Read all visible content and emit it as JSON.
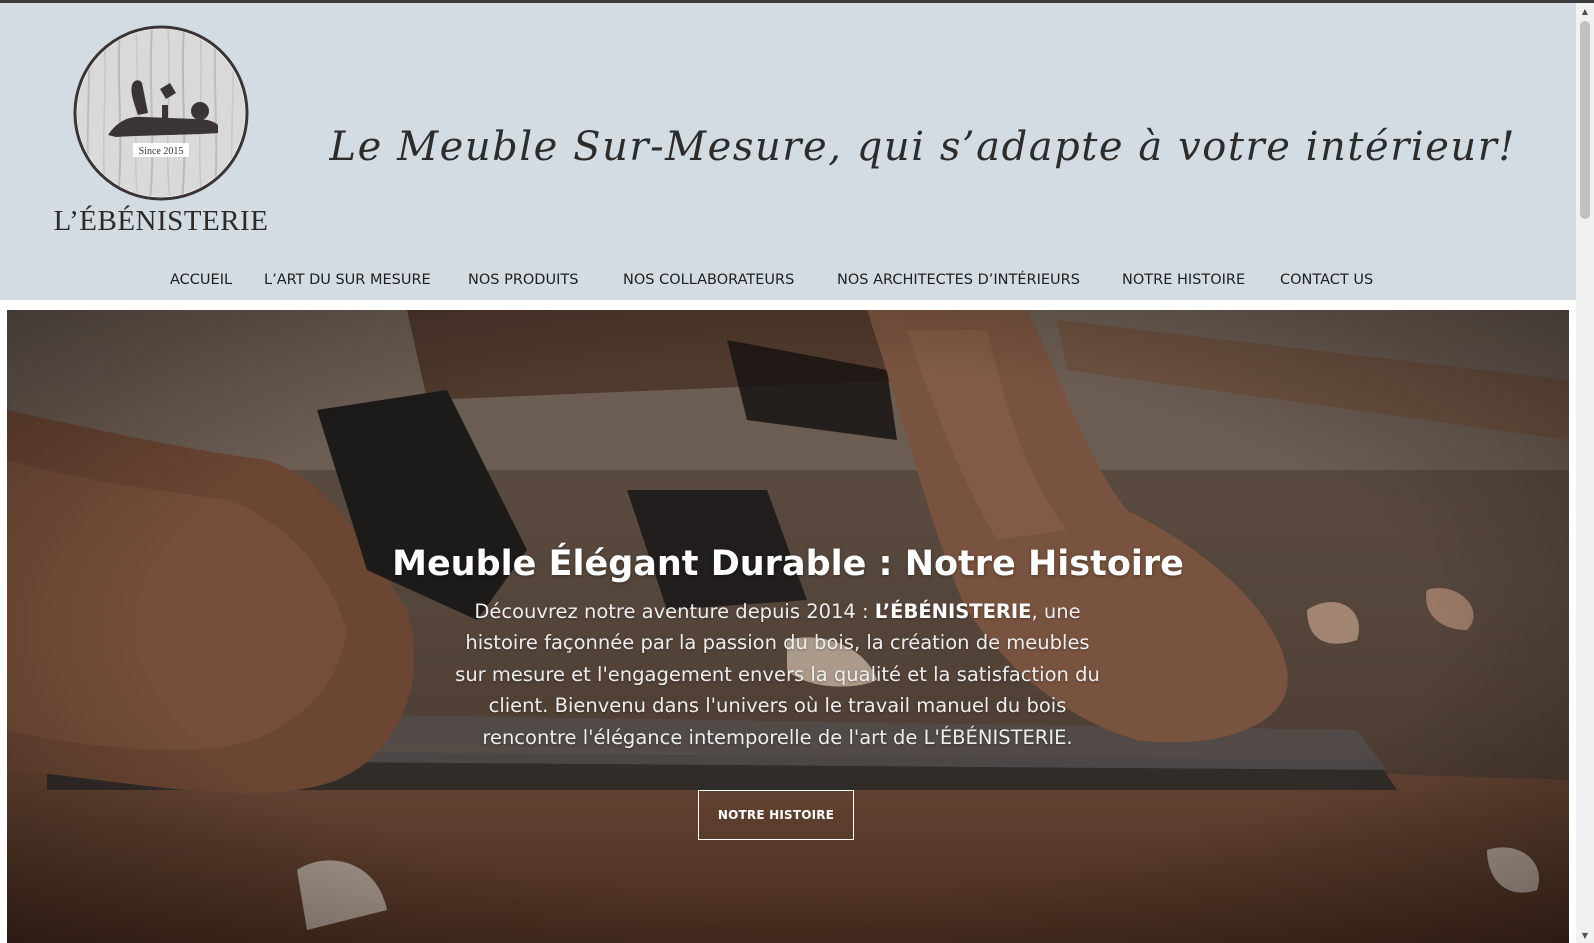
{
  "header": {
    "logo": {
      "badge_text": "Since 2015",
      "brand_name": "L’ÉBÉNISTERIE"
    },
    "tagline": "Le Meuble Sur-Mesure, qui s’adapte à votre intérieur!"
  },
  "nav": {
    "items": [
      {
        "label": "ACCUEIL"
      },
      {
        "label": "L’ART DU SUR MESURE"
      },
      {
        "label": "NOS PRODUITS"
      },
      {
        "label": "NOS COLLABORATEURS"
      },
      {
        "label": "NOS ARCHITECTES D’INTÉRIEURS"
      },
      {
        "label": "NOTRE HISTOIRE"
      },
      {
        "label": "CONTACT US"
      }
    ]
  },
  "hero": {
    "title": "Meuble Élégant Durable : Notre Histoire",
    "text_before": "Découvrez notre aventure depuis 2014 : ",
    "text_brand": "L’ÉBÉNISTERIE",
    "text_after": ", une histoire façonnée par la passion du bois, la création de meubles sur mesure et l'engagement envers la qualité et la satisfaction du client. Bienvenu dans l'univers où le travail manuel du bois rencontre l'élégance intemporelle de l'art de L'ÉBÉNISTERIE.",
    "button_label": "NOTRE HISTOIRE"
  },
  "colors": {
    "header_background": "#d3dbe3",
    "nav_text": "#1f1f1f",
    "hero_text": "#ffffff"
  },
  "icons": {
    "logo": "hand-plane-icon",
    "scroll_up": "triangle-up-icon",
    "scroll_down": "triangle-down-icon"
  }
}
